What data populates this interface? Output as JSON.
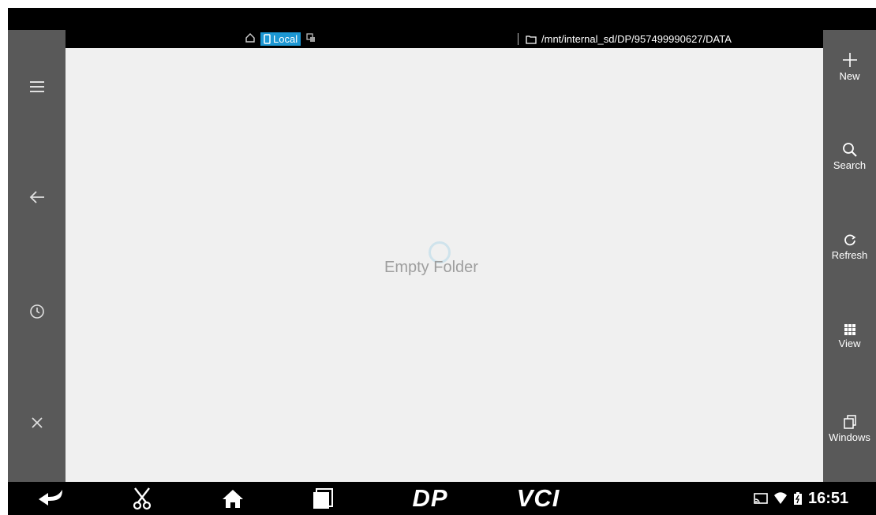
{
  "location_bar": {
    "home_icon": "home-outline-icon",
    "local_label": "Local",
    "path": "/mnt/internal_sd/DP/957499990627/DATA"
  },
  "content": {
    "empty_message": "Empty Folder"
  },
  "left_toolbar": [
    {
      "icon": "menu-icon"
    },
    {
      "icon": "back-arrow-icon"
    },
    {
      "icon": "history-clock-icon"
    },
    {
      "icon": "close-icon"
    }
  ],
  "right_toolbar": {
    "new_label": "New",
    "search_label": "Search",
    "refresh_label": "Refresh",
    "view_label": "View",
    "windows_label": "Windows"
  },
  "navbar": {
    "brand_dp": "DP",
    "brand_vci": "VCI"
  },
  "status": {
    "time": "16:51"
  },
  "colors": {
    "accent": "#1c97d3",
    "sidebar": "#595959",
    "content_bg": "#f0f0f0"
  }
}
